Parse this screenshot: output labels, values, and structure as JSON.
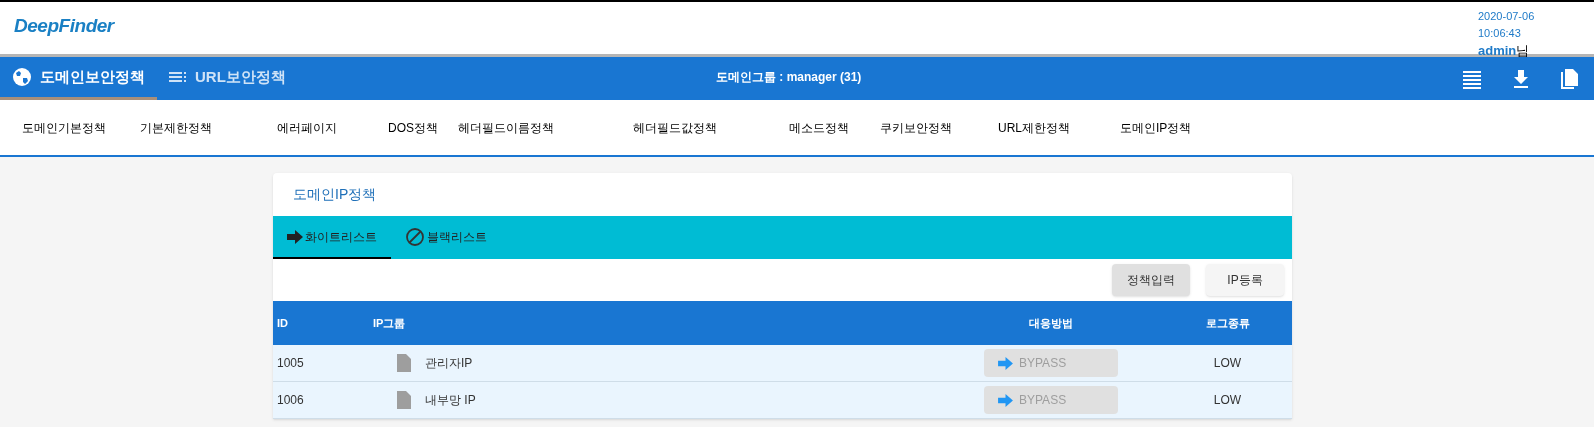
{
  "header": {
    "logo": "DeepFinder",
    "date": "2020-07-06",
    "time": "10:06:43",
    "user": "admin",
    "user_suffix": "님"
  },
  "main_tabs": [
    {
      "label": "도메인보안정책",
      "kind": "globe",
      "selected": true
    },
    {
      "label": "URL보안정책",
      "kind": "list",
      "selected": false
    }
  ],
  "group_label": "도메인그룹 : manager (31)",
  "policy_menu": [
    "도메인기본정책",
    "기본제한정책",
    "에러페이지",
    "DOS정책",
    "헤더필드이름정책",
    "헤더필드값정책",
    "메소드정책",
    "쿠키보안정책",
    "URL제한정책",
    "도메인IP정책"
  ],
  "card": {
    "title": "도메인IP정책",
    "list_tabs": [
      {
        "label": "화이트리스트",
        "kind": "arrow",
        "selected": true
      },
      {
        "label": "블랙리스트",
        "kind": "blocked",
        "selected": false
      }
    ],
    "buttons": [
      {
        "label": "정책입력",
        "kind": "dark"
      },
      {
        "label": "IP등록",
        "kind": "light"
      }
    ],
    "table": {
      "columns": [
        "ID",
        "IP그룹",
        "대응방법",
        "로그종류"
      ],
      "rows": [
        {
          "id": "1005",
          "group": "관리자IP",
          "action": "BYPASS",
          "log": "LOW"
        },
        {
          "id": "1006",
          "group": "내부망 IP",
          "action": "BYPASS",
          "log": "LOW"
        }
      ]
    }
  }
}
